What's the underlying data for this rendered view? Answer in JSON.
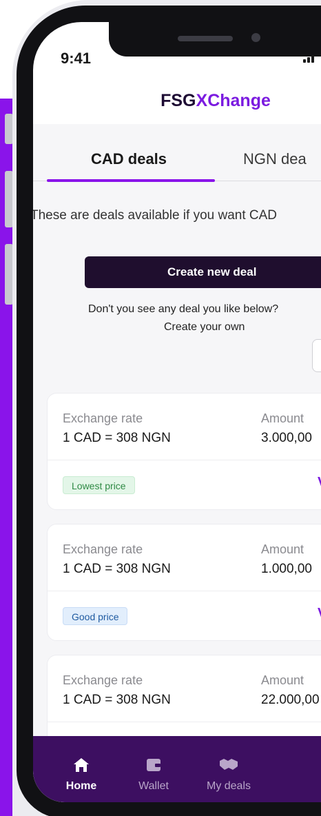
{
  "status_bar": {
    "time": "9:41"
  },
  "header": {
    "brand_part1": "FSG",
    "brand_part2": "XChange"
  },
  "tabs": [
    {
      "label": "CAD deals",
      "active": true
    },
    {
      "label": "NGN dea",
      "active": false
    }
  ],
  "info_text": "These are deals available if you want CAD",
  "create_button": {
    "label": "Create new deal"
  },
  "hint": {
    "line1": "Don't you see any deal you like below?",
    "line2": "Create your own"
  },
  "deals": [
    {
      "rate_label": "Exchange rate",
      "rate": "1 CAD = 308 NGN",
      "amount_label": "Amount",
      "amount": "3.000,00",
      "badge": "Lowest price",
      "badge_color": "#2f8a45",
      "action": "V"
    },
    {
      "rate_label": "Exchange rate",
      "rate": "1 CAD = 308 NGN",
      "amount_label": "Amount",
      "amount": "1.000,00",
      "badge": "Good price",
      "badge_color": "#1f5aa0",
      "action": "V"
    },
    {
      "rate_label": "Exchange rate",
      "rate": "1 CAD = 308 NGN",
      "amount_label": "Amount",
      "amount": "22.000,00"
    }
  ],
  "bottom_nav": [
    {
      "label": "Home",
      "icon": "home-icon",
      "active": true
    },
    {
      "label": "Wallet",
      "icon": "wallet-icon",
      "active": false
    },
    {
      "label": "My deals",
      "icon": "handshake-icon",
      "active": false
    }
  ],
  "colors": {
    "accent": "#8a14ea",
    "brand_dark": "#1d0b33",
    "nav_bg": "#3d0f61",
    "button_bg": "#1f0e2e"
  }
}
